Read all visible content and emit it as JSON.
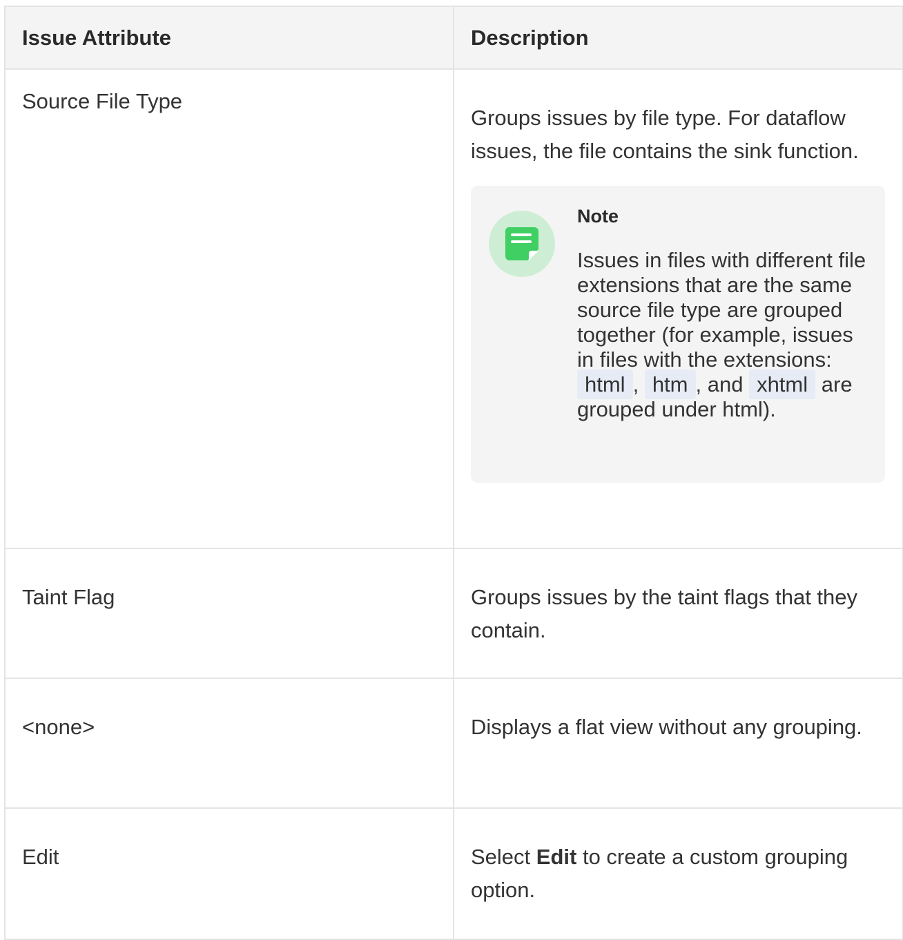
{
  "table": {
    "headers": {
      "attribute": "Issue Attribute",
      "description": "Description"
    },
    "rows": [
      {
        "attribute": "Source File Type",
        "description": "Groups issues by file type. For dataflow issues, the file contains the sink function.",
        "note": {
          "title": "Note",
          "body_part1": "Issues in files with different file extensions that are the same source file type are grouped together (for example, issues in files with the extensions: ",
          "code1": "html",
          "sep1": ", ",
          "code2": "htm",
          "sep2": ", and ",
          "code3": "xhtml",
          "body_part2": " are grouped under html)."
        }
      },
      {
        "attribute": "Taint Flag",
        "description": "Groups issues by the taint flags that they contain."
      },
      {
        "attribute": "<none>",
        "description": "Displays a flat view without any grouping."
      },
      {
        "attribute": "Edit",
        "description_pre": "Select ",
        "description_bold": "Edit",
        "description_post": " to create a custom grouping option."
      }
    ]
  },
  "icons": {
    "note": "note-icon"
  },
  "colors": {
    "header_bg": "#f4f4f4",
    "note_bg": "#f4f4f4",
    "note_icon_circle": "#cdeed4",
    "note_icon": "#3fcf63",
    "code_bg": "#e6ebf5"
  }
}
